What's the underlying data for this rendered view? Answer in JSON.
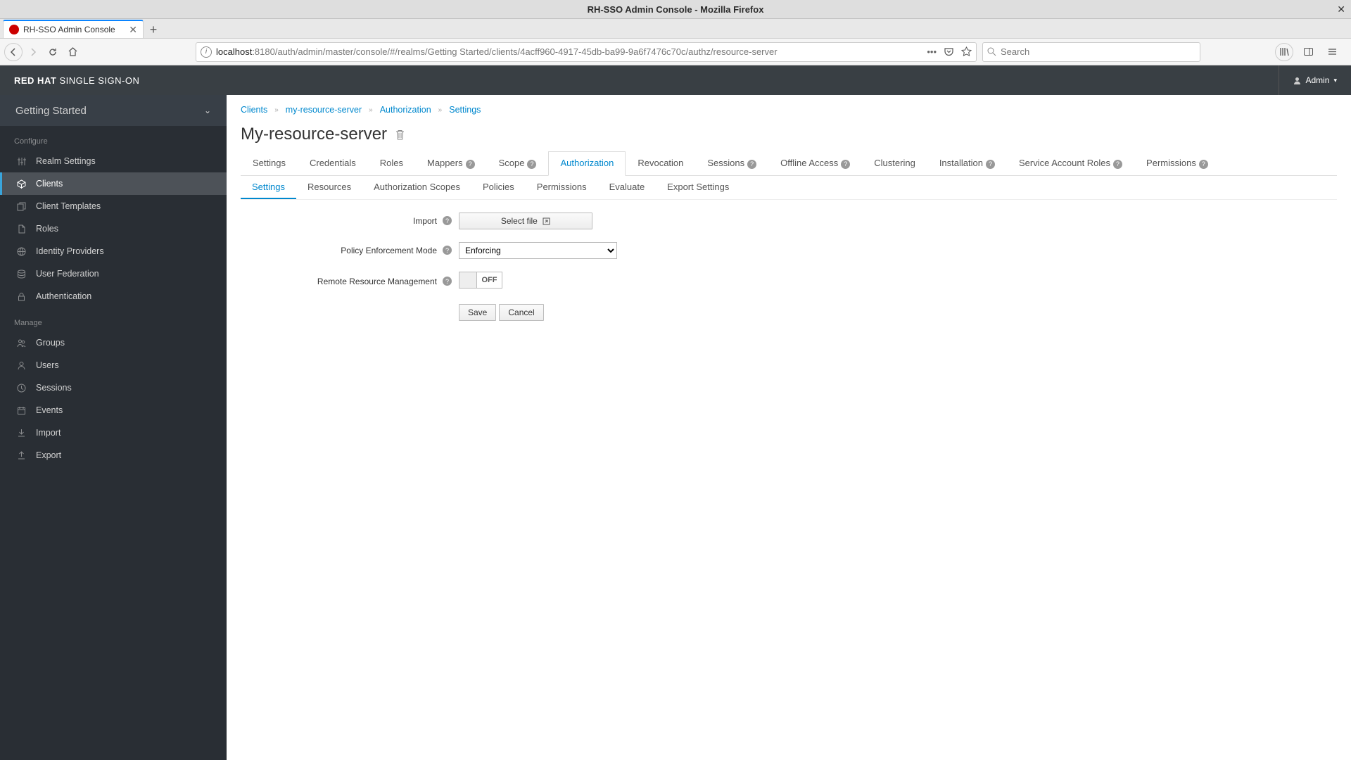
{
  "browser": {
    "window_title": "RH-SSO Admin Console - Mozilla Firefox",
    "tab_title": "RH-SSO Admin Console",
    "url_host": "localhost",
    "url_rest": ":8180/auth/admin/master/console/#/realms/Getting Started/clients/4acff960-4917-45db-ba99-9a6f7476c70c/authz/resource-server",
    "search_placeholder": "Search"
  },
  "header": {
    "logo_bold": "RED HAT",
    "logo_rest": "SINGLE SIGN-ON",
    "user": "Admin"
  },
  "sidebar": {
    "realm": "Getting Started",
    "sections": [
      {
        "label": "Configure",
        "items": [
          {
            "label": "Realm Settings",
            "icon": "sliders"
          },
          {
            "label": "Clients",
            "icon": "cube",
            "active": true
          },
          {
            "label": "Client Templates",
            "icon": "copy"
          },
          {
            "label": "Roles",
            "icon": "file"
          },
          {
            "label": "Identity Providers",
            "icon": "globe"
          },
          {
            "label": "User Federation",
            "icon": "database"
          },
          {
            "label": "Authentication",
            "icon": "lock"
          }
        ]
      },
      {
        "label": "Manage",
        "items": [
          {
            "label": "Groups",
            "icon": "users"
          },
          {
            "label": "Users",
            "icon": "user"
          },
          {
            "label": "Sessions",
            "icon": "clock"
          },
          {
            "label": "Events",
            "icon": "calendar"
          },
          {
            "label": "Import",
            "icon": "import"
          },
          {
            "label": "Export",
            "icon": "export"
          }
        ]
      }
    ]
  },
  "breadcrumb": [
    "Clients",
    "my-resource-server",
    "Authorization",
    "Settings"
  ],
  "page_title": "My-resource-server",
  "tabs": [
    {
      "label": "Settings"
    },
    {
      "label": "Credentials"
    },
    {
      "label": "Roles"
    },
    {
      "label": "Mappers",
      "help": true
    },
    {
      "label": "Scope",
      "help": true
    },
    {
      "label": "Authorization",
      "selected": true
    },
    {
      "label": "Revocation"
    },
    {
      "label": "Sessions",
      "help": true
    },
    {
      "label": "Offline Access",
      "help": true
    },
    {
      "label": "Clustering"
    },
    {
      "label": "Installation",
      "help": true
    },
    {
      "label": "Service Account Roles",
      "help": true
    },
    {
      "label": "Permissions",
      "help": true
    }
  ],
  "subtabs": [
    {
      "label": "Settings",
      "selected": true
    },
    {
      "label": "Resources"
    },
    {
      "label": "Authorization Scopes"
    },
    {
      "label": "Policies"
    },
    {
      "label": "Permissions"
    },
    {
      "label": "Evaluate"
    },
    {
      "label": "Export Settings"
    }
  ],
  "form": {
    "import_label": "Import",
    "select_file": "Select file",
    "pem_label": "Policy Enforcement Mode",
    "pem_value": "Enforcing",
    "rrm_label": "Remote Resource Management",
    "rrm_state": "OFF",
    "save": "Save",
    "cancel": "Cancel"
  }
}
